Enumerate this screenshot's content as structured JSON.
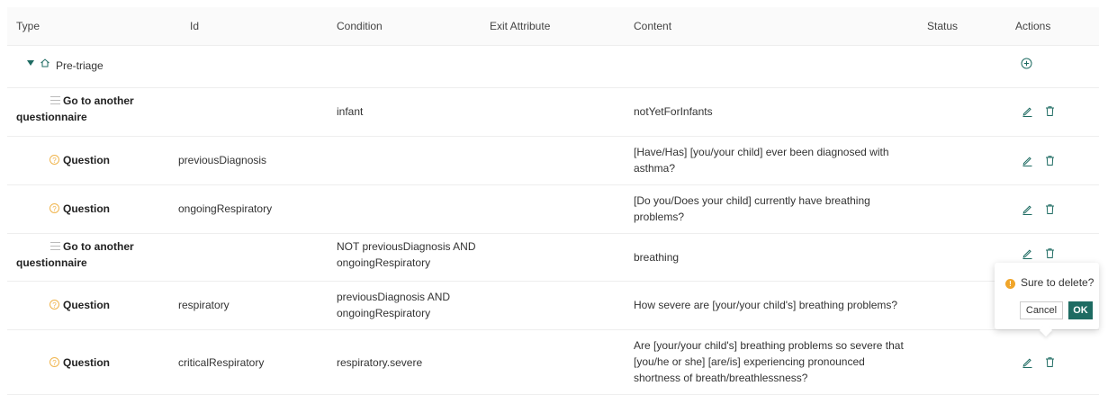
{
  "columns": {
    "type": "Type",
    "id": "Id",
    "condition": "Condition",
    "exit_attribute": "Exit Attribute",
    "content": "Content",
    "status": "Status",
    "actions": "Actions"
  },
  "group": {
    "label": "Pre-triage"
  },
  "rows": [
    {
      "type_line1": "Go to another",
      "type_line2": "questionnaire",
      "id": "",
      "condition_line1": "infant",
      "condition_line2": "",
      "content_line1": "notYetForInfants",
      "content_line2": "",
      "content_line3": ""
    },
    {
      "type_line1": "Question",
      "id": "previousDiagnosis",
      "condition_line1": "",
      "condition_line2": "",
      "content_line1": "[Have/Has] [you/your child] ever been diagnosed with",
      "content_line2": "asthma?",
      "content_line3": ""
    },
    {
      "type_line1": "Question",
      "id": "ongoingRespiratory",
      "condition_line1": "",
      "condition_line2": "",
      "content_line1": "[Do you/Does your child] currently have breathing",
      "content_line2": "problems?",
      "content_line3": ""
    },
    {
      "type_line1": "Go to another",
      "type_line2": "questionnaire",
      "id": "",
      "condition_line1": "NOT previousDiagnosis AND",
      "condition_line2": "ongoingRespiratory",
      "content_line1": "breathing",
      "content_line2": "",
      "content_line3": ""
    },
    {
      "type_line1": "Question",
      "id": "respiratory",
      "condition_line1": "previousDiagnosis AND",
      "condition_line2": "ongoingRespiratory",
      "content_line1": "How severe are [your/your child's] breathing problems?",
      "content_line2": "",
      "content_line3": ""
    },
    {
      "type_line1": "Question",
      "id": "criticalRespiratory",
      "condition_line1": "respiratory.severe",
      "condition_line2": "",
      "content_line1": "Are [your/your child's] breathing problems so severe that",
      "content_line2": "[you/he or she] [are/is] experiencing pronounced",
      "content_line3": "shortness of breath/breathlessness?"
    }
  ],
  "popconfirm": {
    "message": "Sure to delete?",
    "cancel_label": "Cancel",
    "ok_label": "OK"
  },
  "colors": {
    "accent": "#1e6b62",
    "question_icon": "#f0b44c",
    "warning": "#f0a52a"
  }
}
